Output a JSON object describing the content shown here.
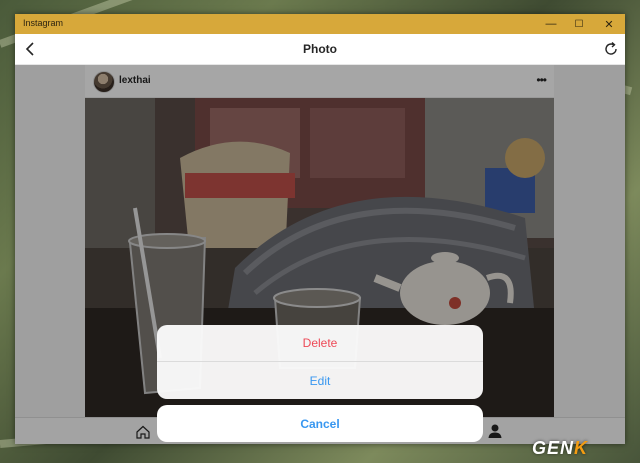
{
  "window": {
    "title": "Instagram",
    "titlebar_color": "#d7a83a",
    "controls": {
      "minimize": "—",
      "maximize": "☐",
      "close": "✕"
    }
  },
  "navbar": {
    "title": "Photo",
    "back_icon": "chevron-left-icon",
    "refresh_icon": "refresh-icon"
  },
  "post": {
    "username": "lexthai",
    "more_icon": "ellipsis-icon"
  },
  "bottom_bar": {
    "left_icon": "home-icon",
    "right_icon": "profile-icon"
  },
  "action_sheet": {
    "delete_label": "Delete",
    "edit_label": "Edit",
    "cancel_label": "Cancel",
    "delete_color": "#ed4956",
    "action_color": "#3897f0"
  },
  "watermark": {
    "text_main": "GEN",
    "text_accent": "K"
  }
}
